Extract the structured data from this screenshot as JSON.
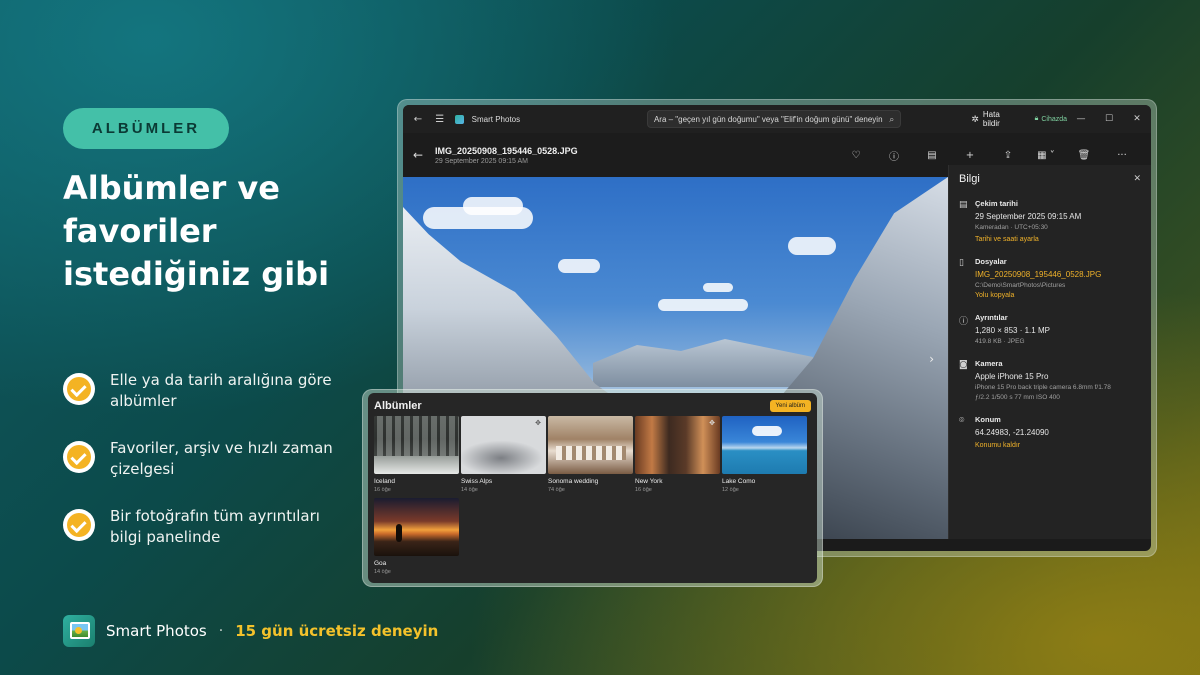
{
  "promo": {
    "pill": "ALBÜMLER",
    "headline_lines": [
      "Albümler ve",
      "favoriler",
      "istediğiniz gibi"
    ],
    "features": [
      {
        "line1": "Elle ya da tarih aralığına göre",
        "line2": "albümler"
      },
      {
        "line1": "Favoriler, arşiv ve hızlı zaman",
        "line2": "çizelgesi"
      },
      {
        "line1": "Bir fotoğrafın tüm ayrıntıları",
        "line2": "bilgi panelinde"
      }
    ],
    "brand_name": "Smart Photos",
    "brand_separator": "·",
    "trial": "15 gün ücretsiz deneyin"
  },
  "window": {
    "app_title": "Smart Photos",
    "search_placeholder": "Ara – \"geçen yıl gün doğumu\" veya \"Elif'in doğum günü\" deneyin",
    "report_bug": "Hata bildir",
    "on_device": "Cihazda",
    "file_name": "IMG_20250908_195446_0528.JPG",
    "file_date": "29 September 2025 09:15 AM"
  },
  "info": {
    "title": "Bilgi",
    "sections": {
      "date": {
        "label": "Çekim tarihi",
        "main": "29 September 2025 09:15 AM",
        "sub": "Kameradan · UTC+05:30",
        "link": "Tarihi ve saati ayarla"
      },
      "files": {
        "label": "Dosyalar",
        "main": "IMG_20250908_195446_0528.JPG",
        "sub": "C:\\Demo\\SmartPhotos\\Pictures",
        "link": "Yolu kopyala"
      },
      "details": {
        "label": "Ayrıntılar",
        "main": "1,280 × 853 · 1.1 MP",
        "sub": "419.8 KB · JPEG"
      },
      "camera": {
        "label": "Kamera",
        "main": "Apple iPhone 15 Pro",
        "sub": "iPhone 15 Pro back triple camera 6.8mm f/1.78",
        "sub2": "ƒ/2.2    1/500 s    77 mm    ISO 400"
      },
      "location": {
        "label": "Konum",
        "main": "64.24983, -21.24090",
        "link": "Konumu kaldır"
      }
    }
  },
  "albums": {
    "title": "Albümler",
    "new_album": "Yeni albüm",
    "items": [
      {
        "name": "Iceland",
        "count": "16 öğe"
      },
      {
        "name": "Swiss Alps",
        "count": "14 öğe"
      },
      {
        "name": "Sonoma wedding",
        "count": "74 öğe"
      },
      {
        "name": "New York",
        "count": "16 öğe"
      },
      {
        "name": "Lake Como",
        "count": "12 öğe"
      },
      {
        "name": "Goa",
        "count": "14 öğe"
      }
    ]
  },
  "colors": {
    "accent_yellow": "#f4b323",
    "pill_teal": "#44c0a8",
    "link_orange": "#f0b22a"
  },
  "icons": [
    "check-icon",
    "back-arrow-icon",
    "menu-icon",
    "search-icon",
    "bug-icon",
    "lock-icon",
    "minimize-icon",
    "maximize-icon",
    "close-icon",
    "heart-icon",
    "info-icon",
    "edit-icon",
    "add-icon",
    "share-icon",
    "slideshow-icon",
    "delete-icon",
    "more-icon",
    "calendar-icon",
    "file-icon",
    "details-icon",
    "camera-icon",
    "location-icon",
    "pin-icon",
    "chevron-right-icon"
  ]
}
